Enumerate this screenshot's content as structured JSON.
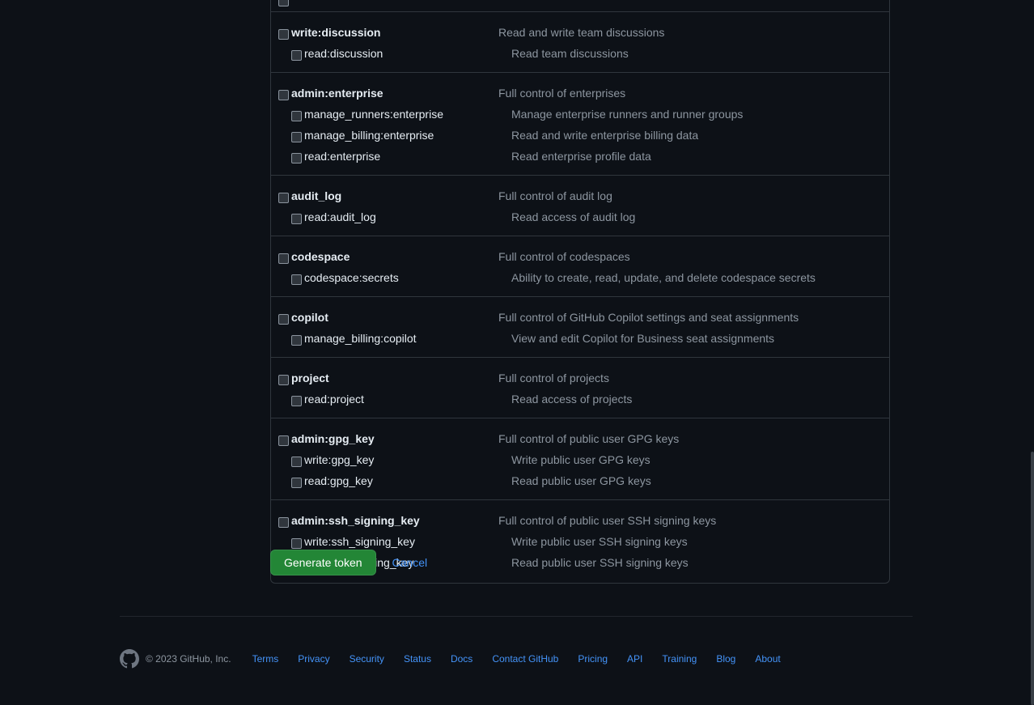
{
  "scopes": [
    {
      "name": "write:discussion",
      "description": "Read and write team discussions",
      "children": [
        {
          "name": "read:discussion",
          "description": "Read team discussions"
        }
      ]
    },
    {
      "name": "admin:enterprise",
      "description": "Full control of enterprises",
      "children": [
        {
          "name": "manage_runners:enterprise",
          "description": "Manage enterprise runners and runner groups"
        },
        {
          "name": "manage_billing:enterprise",
          "description": "Read and write enterprise billing data"
        },
        {
          "name": "read:enterprise",
          "description": "Read enterprise profile data"
        }
      ]
    },
    {
      "name": "audit_log",
      "description": "Full control of audit log",
      "children": [
        {
          "name": "read:audit_log",
          "description": "Read access of audit log"
        }
      ]
    },
    {
      "name": "codespace",
      "description": "Full control of codespaces",
      "children": [
        {
          "name": "codespace:secrets",
          "description": "Ability to create, read, update, and delete codespace secrets"
        }
      ]
    },
    {
      "name": "copilot",
      "description": "Full control of GitHub Copilot settings and seat assignments",
      "children": [
        {
          "name": "manage_billing:copilot",
          "description": "View and edit Copilot for Business seat assignments"
        }
      ]
    },
    {
      "name": "project",
      "description": "Full control of projects",
      "children": [
        {
          "name": "read:project",
          "description": "Read access of projects"
        }
      ]
    },
    {
      "name": "admin:gpg_key",
      "description": "Full control of public user GPG keys",
      "children": [
        {
          "name": "write:gpg_key",
          "description": "Write public user GPG keys"
        },
        {
          "name": "read:gpg_key",
          "description": "Read public user GPG keys"
        }
      ]
    },
    {
      "name": "admin:ssh_signing_key",
      "description": "Full control of public user SSH signing keys",
      "children": [
        {
          "name": "write:ssh_signing_key",
          "description": "Write public user SSH signing keys"
        },
        {
          "name": "read:ssh_signing_key",
          "description": "Read public user SSH signing keys"
        }
      ]
    }
  ],
  "actions": {
    "generate_label": "Generate token",
    "cancel_label": "Cancel"
  },
  "footer": {
    "copyright": "© 2023 GitHub, Inc.",
    "logo_icon": "github-mark-icon",
    "links": [
      "Terms",
      "Privacy",
      "Security",
      "Status",
      "Docs",
      "Contact GitHub",
      "Pricing",
      "API",
      "Training",
      "Blog",
      "About"
    ]
  },
  "colors": {
    "background": "#0d1117",
    "primary_button": "#238636",
    "link": "#4493f8",
    "muted_text": "#8d96a0"
  }
}
